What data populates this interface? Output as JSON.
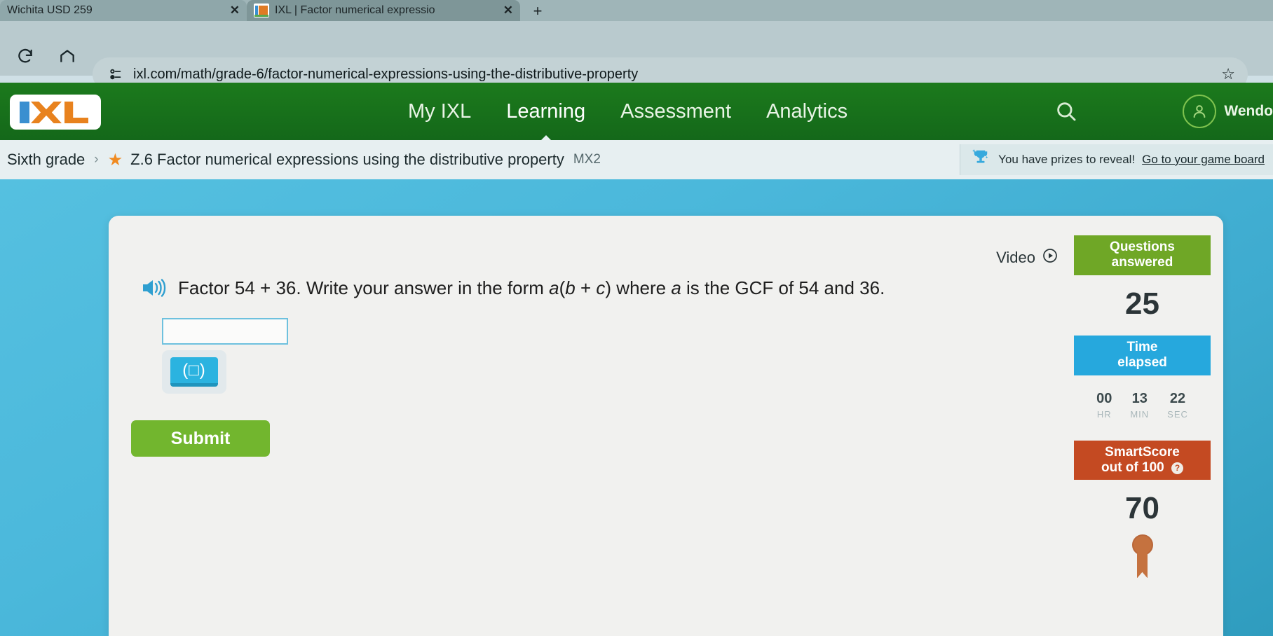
{
  "browser": {
    "tabs": [
      {
        "title": "Wichita USD 259",
        "active": false,
        "favicon": "none"
      },
      {
        "title": "IXL | Factor numerical expressio",
        "active": true,
        "favicon": "ixl-favicon"
      }
    ],
    "new_tab_label": "+",
    "close_label": "✕",
    "reload_icon": "reload-icon",
    "home_icon": "home-icon",
    "site_settings_icon": "site-settings-icon",
    "url": "ixl.com/math/grade-6/factor-numerical-expressions-using-the-distributive-property",
    "bookmark_icon": "☆"
  },
  "nav": {
    "logo_alt": "IXL",
    "links": [
      {
        "label": "My IXL",
        "active": false
      },
      {
        "label": "Learning",
        "active": true
      },
      {
        "label": "Assessment",
        "active": false
      },
      {
        "label": "Analytics",
        "active": false
      }
    ],
    "search_icon": "search-icon",
    "user_name": "Wendo",
    "avatar_icon": "user-avatar-icon"
  },
  "breadcrumb": {
    "grade": "Sixth grade",
    "separator": "›",
    "star": "★",
    "skill_title": "Z.6 Factor numerical expressions using the distributive property",
    "skill_code": "MX2"
  },
  "prize_banner": {
    "trophy_icon": "trophy-icon",
    "text": "You have prizes to reveal!",
    "link": "Go to your game board"
  },
  "question": {
    "speaker_icon": "speaker-icon",
    "prefix": "Factor 54 + 36. Write your answer in the form ",
    "form_a": "a",
    "form_open": "(",
    "form_b": "b",
    "form_plus": " + ",
    "form_c": "c",
    "form_close": ")",
    "middle": " where ",
    "var_a": "a",
    "suffix": " is the GCF of 54 and 36."
  },
  "answer": {
    "value": "",
    "placeholder": "",
    "keypad_label": "(□)",
    "submit_label": "Submit"
  },
  "video": {
    "label": "Video",
    "play_icon": "play-circle-icon"
  },
  "score_panel": {
    "questions_answered": {
      "line1": "Questions",
      "line2": "answered",
      "value": "25",
      "color": "#6fa726"
    },
    "time_elapsed": {
      "line1": "Time",
      "line2": "elapsed",
      "color": "#26a8dd",
      "hours": "00",
      "minutes": "13",
      "seconds": "22",
      "hours_unit": "HR",
      "minutes_unit": "MIN",
      "seconds_unit": "SEC"
    },
    "smartscore": {
      "line1": "SmartScore",
      "line2": "out of 100",
      "help_icon": "?",
      "value": "70",
      "color": "#c44a22",
      "medal_icon": "bronze-medal-icon"
    }
  }
}
